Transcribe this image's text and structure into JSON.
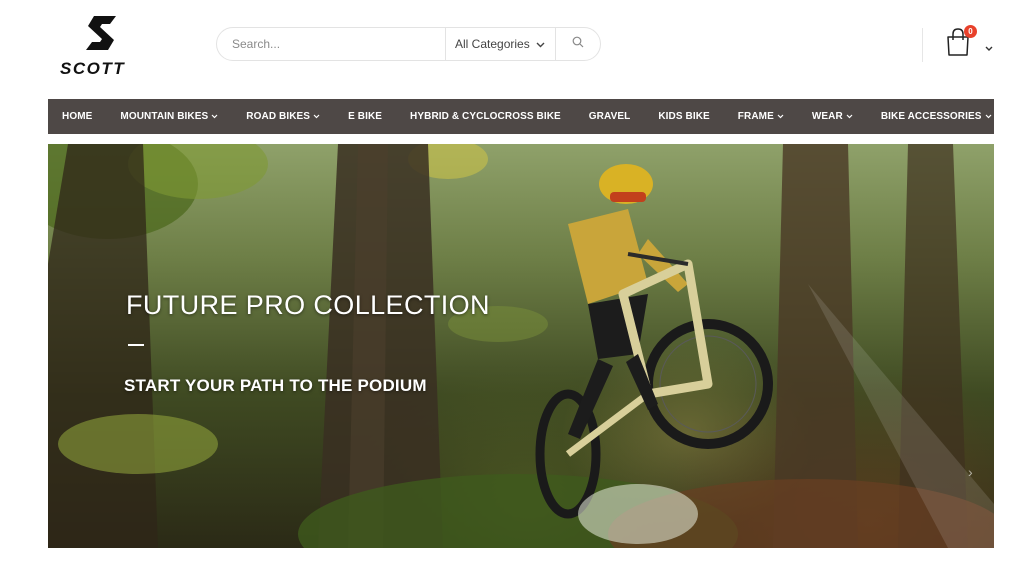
{
  "brand": {
    "logo_text": "SCOTT"
  },
  "search": {
    "placeholder": "Search...",
    "category": "All Categories"
  },
  "cart": {
    "count": "0"
  },
  "nav": {
    "items": [
      {
        "label": "HOME",
        "dropdown": false
      },
      {
        "label": "MOUNTAIN BIKES",
        "dropdown": true
      },
      {
        "label": "ROAD BIKES",
        "dropdown": true
      },
      {
        "label": "E BIKE",
        "dropdown": false
      },
      {
        "label": "HYBRID & CYCLOCROSS BIKE",
        "dropdown": false
      },
      {
        "label": "GRAVEL",
        "dropdown": false
      },
      {
        "label": "KIDS BIKE",
        "dropdown": false
      },
      {
        "label": "FRAME",
        "dropdown": true
      },
      {
        "label": "WEAR",
        "dropdown": true
      },
      {
        "label": "BIKE ACCESSORIES",
        "dropdown": true
      }
    ]
  },
  "hero": {
    "title": "FUTURE PRO COLLECTION",
    "subtitle": "START YOUR PATH TO THE PODIUM"
  },
  "colors": {
    "nav_bg": "#4e4846",
    "badge": "#e8412b",
    "text_dark": "#111111"
  }
}
